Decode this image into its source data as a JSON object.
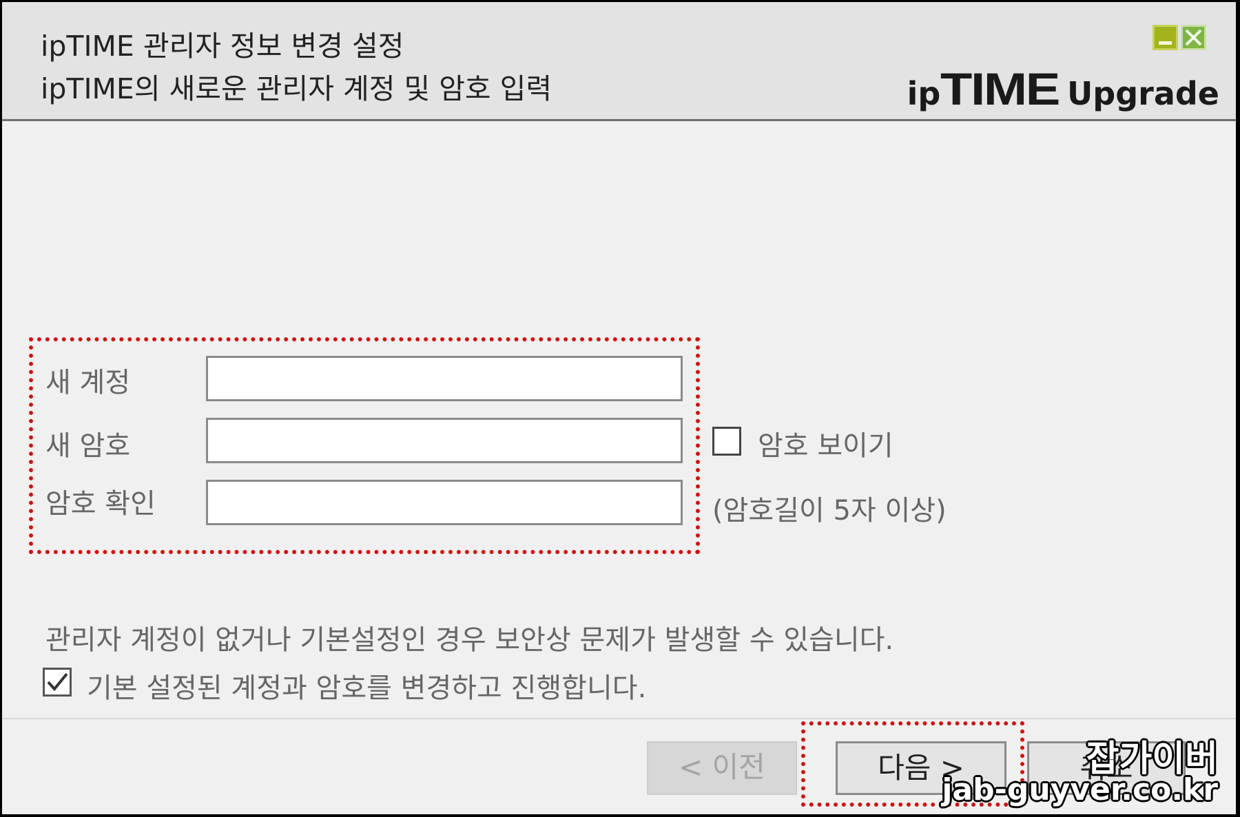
{
  "header": {
    "title": "ipTIME 관리자 정보 변경 설정",
    "subtitle": "ipTIME의 새로운 관리자 계정 및 암호 입력",
    "logo_ip": "ip",
    "logo_time": "TIME",
    "logo_upgrade": "Upgrade"
  },
  "window_controls": {
    "minimize_icon": "minimize-icon",
    "close_icon": "close-icon",
    "minimize_color": "#a3b31c",
    "close_color": "#7fb543"
  },
  "form": {
    "new_account_label": "새 계정",
    "new_account_value": "",
    "new_password_label": "새 암호",
    "new_password_value": "",
    "confirm_password_label": "암호 확인",
    "confirm_password_value": "",
    "show_password_label": "암호 보이기",
    "show_password_checked": false,
    "password_hint": "(암호길이 5자 이상)"
  },
  "warning_text": "관리자 계정이 없거나 기본설정인 경우 보안상 문제가 발생할 수 있습니다.",
  "confirm_change_label": "기본 설정된 계정과 암호를 변경하고 진행합니다.",
  "confirm_change_checked": true,
  "buttons": {
    "prev": "< 이전",
    "next": "다음 >",
    "cancel": "취소"
  },
  "highlight_color": "#d01010",
  "watermark": {
    "line1": "잡가이버",
    "line2": "jab-guyver.co.kr"
  }
}
